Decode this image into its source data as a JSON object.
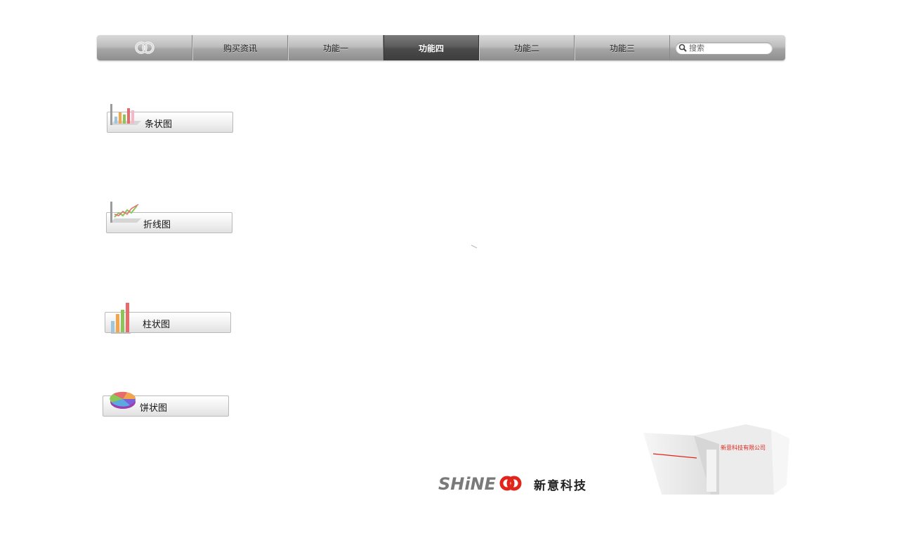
{
  "nav": {
    "items": [
      {
        "label": "",
        "icon": "logo-icon"
      },
      {
        "label": "购买资讯"
      },
      {
        "label": "功能一"
      },
      {
        "label": "功能四",
        "active": true
      },
      {
        "label": "功能二"
      },
      {
        "label": "功能三"
      }
    ],
    "search": {
      "placeholder": "搜索",
      "icon": "search-icon"
    }
  },
  "charts": {
    "bar": {
      "label": "条状图",
      "icon": "bar-chart-icon"
    },
    "line": {
      "label": "折线图",
      "icon": "line-chart-icon"
    },
    "column": {
      "label": "柱状图",
      "icon": "column-chart-icon"
    },
    "pie": {
      "label": "饼状图",
      "icon": "pie-chart-icon"
    }
  },
  "footer": {
    "brand_logo_text": "SHiNE",
    "brand_name": "新意科技",
    "product_box_text": "新意科技有限公司"
  },
  "colors": {
    "nav_active": "#4a4a4a",
    "brand_red": "#e0261c",
    "brand_gray": "#777777"
  }
}
